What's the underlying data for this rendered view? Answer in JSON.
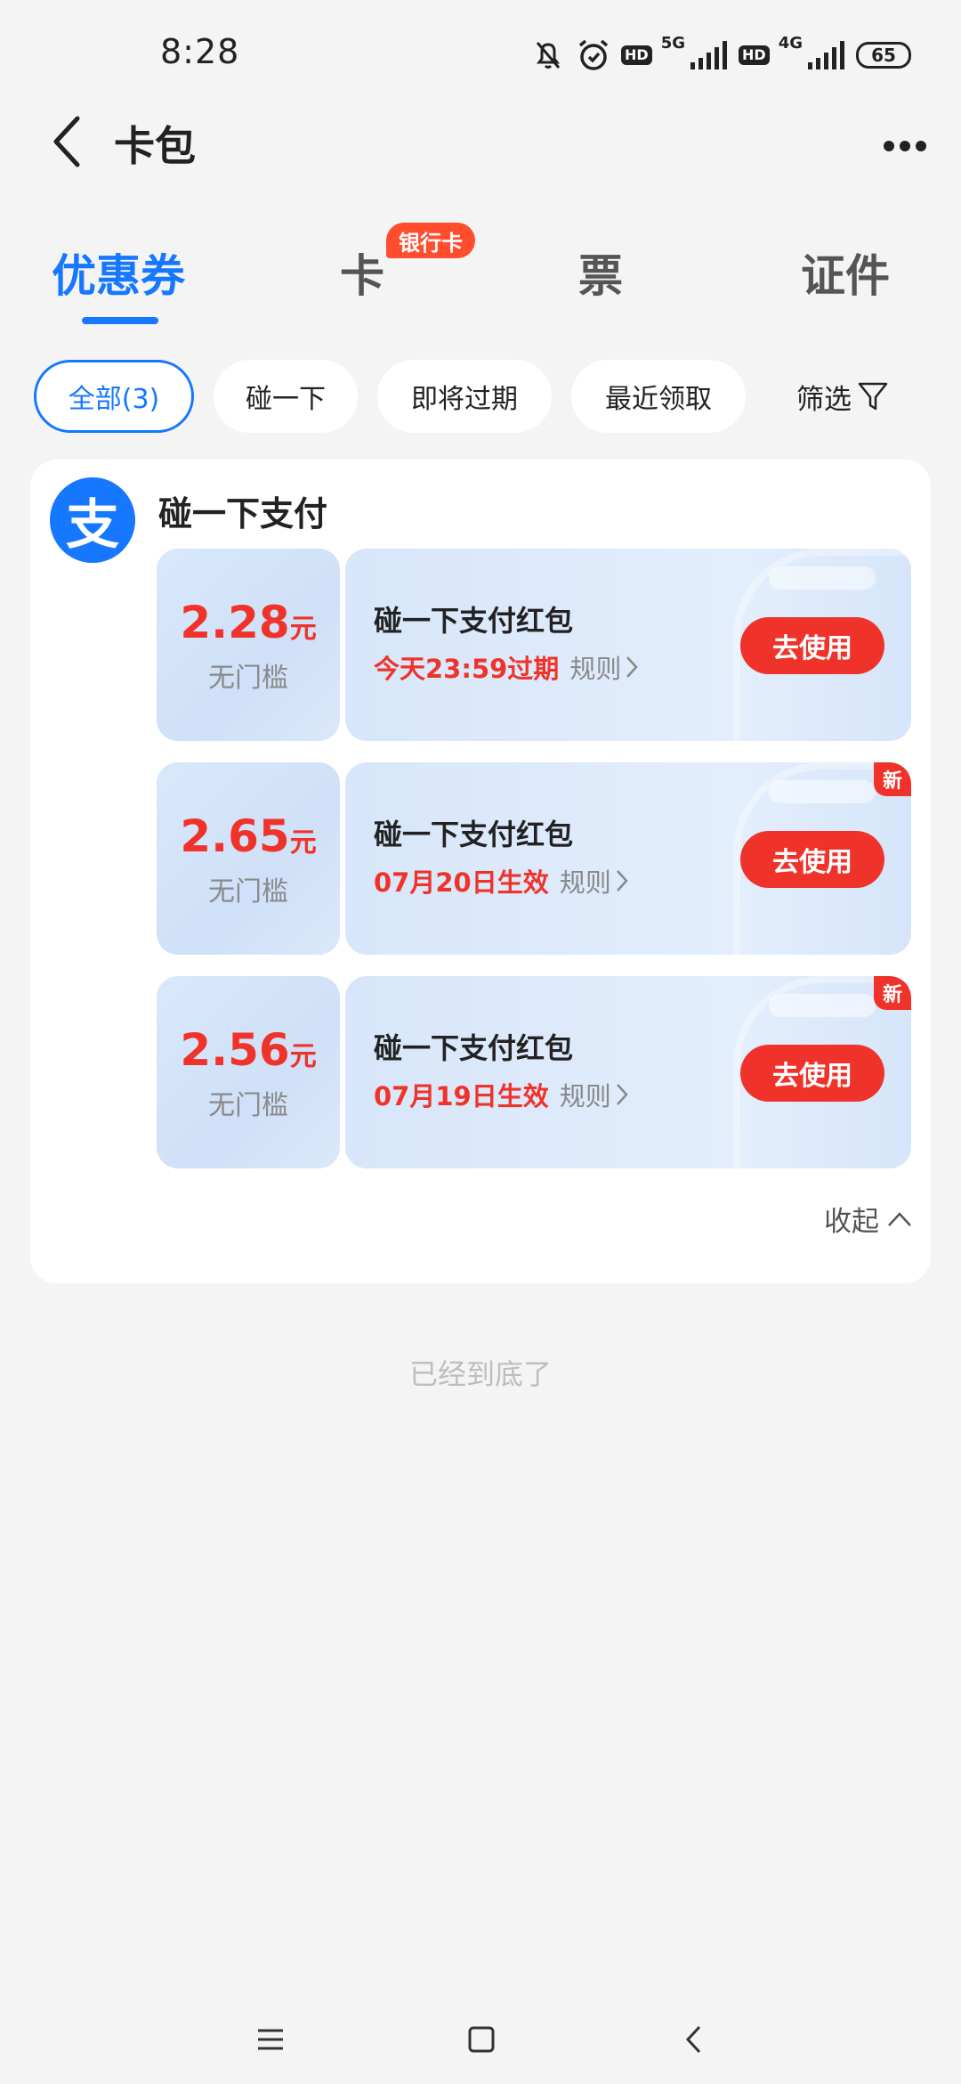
{
  "status_bar": {
    "time": "8:28",
    "hd_label": "HD",
    "network_5g": "5G",
    "network_4g": "4G",
    "battery": "65"
  },
  "nav": {
    "title": "卡包"
  },
  "tabs": [
    {
      "label": "优惠券",
      "active": true
    },
    {
      "label": "卡",
      "badge": "银行卡"
    },
    {
      "label": "票"
    },
    {
      "label": "证件"
    }
  ],
  "chips": [
    {
      "label": "全部(3)",
      "active": true
    },
    {
      "label": "碰一下"
    },
    {
      "label": "即将过期"
    },
    {
      "label": "最近领取"
    }
  ],
  "filter_label": "筛选",
  "merchant": {
    "logo_text": "支",
    "name": "碰一下支付"
  },
  "coupons": [
    {
      "amount": "2.28",
      "unit": "元",
      "threshold": "无门槛",
      "title": "碰一下支付红包",
      "date": "今天23:59过期",
      "rule": "规则",
      "button": "去使用"
    },
    {
      "amount": "2.65",
      "unit": "元",
      "threshold": "无门槛",
      "title": "碰一下支付红包",
      "date": "07月20日生效",
      "rule": "规则",
      "button": "去使用",
      "badge": "新"
    },
    {
      "amount": "2.56",
      "unit": "元",
      "threshold": "无门槛",
      "title": "碰一下支付红包",
      "date": "07月19日生效",
      "rule": "规则",
      "button": "去使用",
      "badge": "新"
    }
  ],
  "collapse_label": "收起",
  "bottom_note": "已经到底了",
  "colors": {
    "accent": "#1677ff",
    "red": "#f0332a",
    "background": "#f4f4f4"
  }
}
